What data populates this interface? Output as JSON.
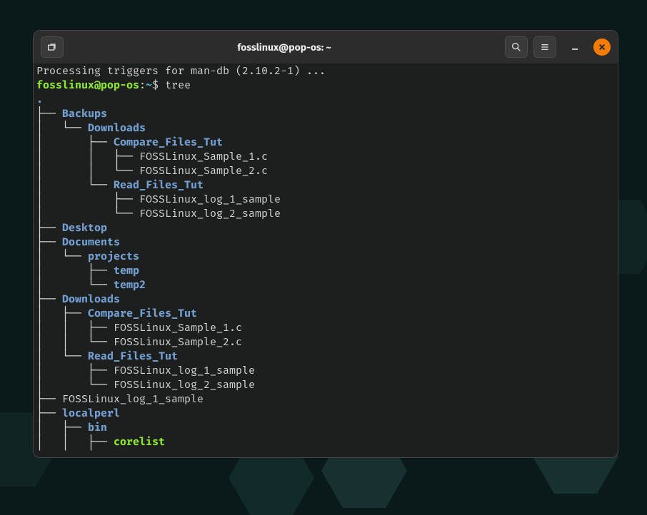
{
  "window": {
    "title": "fosslinux@pop-os: ~"
  },
  "prompt": {
    "user": "fosslinux@pop-os",
    "colon": ":",
    "path": "~",
    "symbol": "$ ",
    "command": "tree"
  },
  "output": {
    "preline": "Processing triggers for man-db (2.10.2-1) ...",
    "root": "."
  },
  "tree": [
    {
      "indent": 0,
      "branch": "├── ",
      "text": "Backups",
      "cls": "dirblue"
    },
    {
      "indent": 1,
      "branch": "└── ",
      "text": "Downloads",
      "cls": "dirblue",
      "pipes": "│   "
    },
    {
      "indent": 2,
      "branch": "├── ",
      "text": "Compare_Files_Tut",
      "cls": "dirblue",
      "pipes": "│       "
    },
    {
      "indent": 3,
      "branch": "├── ",
      "text": "FOSSLinux_Sample_1.c",
      "cls": "white",
      "pipes": "│       │   "
    },
    {
      "indent": 3,
      "branch": "└── ",
      "text": "FOSSLinux_Sample_2.c",
      "cls": "white",
      "pipes": "│       │   "
    },
    {
      "indent": 2,
      "branch": "└── ",
      "text": "Read_Files_Tut",
      "cls": "dirblue",
      "pipes": "│       "
    },
    {
      "indent": 3,
      "branch": "├── ",
      "text": "FOSSLinux_log_1_sample",
      "cls": "white",
      "pipes": "│           "
    },
    {
      "indent": 3,
      "branch": "└── ",
      "text": "FOSSLinux_log_2_sample",
      "cls": "white",
      "pipes": "│           "
    },
    {
      "indent": 0,
      "branch": "├── ",
      "text": "Desktop",
      "cls": "dirblue"
    },
    {
      "indent": 0,
      "branch": "├── ",
      "text": "Documents",
      "cls": "dirblue"
    },
    {
      "indent": 1,
      "branch": "└── ",
      "text": "projects",
      "cls": "dirblue",
      "pipes": "│   "
    },
    {
      "indent": 2,
      "branch": "├── ",
      "text": "temp",
      "cls": "dirblue",
      "pipes": "│       "
    },
    {
      "indent": 2,
      "branch": "└── ",
      "text": "temp2",
      "cls": "dirblue",
      "pipes": "│       "
    },
    {
      "indent": 0,
      "branch": "├── ",
      "text": "Downloads",
      "cls": "dirblue"
    },
    {
      "indent": 1,
      "branch": "├── ",
      "text": "Compare_Files_Tut",
      "cls": "dirblue",
      "pipes": "│   "
    },
    {
      "indent": 2,
      "branch": "├── ",
      "text": "FOSSLinux_Sample_1.c",
      "cls": "white",
      "pipes": "│   │   "
    },
    {
      "indent": 2,
      "branch": "└── ",
      "text": "FOSSLinux_Sample_2.c",
      "cls": "white",
      "pipes": "│   │   "
    },
    {
      "indent": 1,
      "branch": "└── ",
      "text": "Read_Files_Tut",
      "cls": "dirblue",
      "pipes": "│   "
    },
    {
      "indent": 2,
      "branch": "├── ",
      "text": "FOSSLinux_log_1_sample",
      "cls": "white",
      "pipes": "│       "
    },
    {
      "indent": 2,
      "branch": "└── ",
      "text": "FOSSLinux_log_2_sample",
      "cls": "white",
      "pipes": "│       "
    },
    {
      "indent": 0,
      "branch": "├── ",
      "text": "FOSSLinux_log_1_sample",
      "cls": "white"
    },
    {
      "indent": 0,
      "branch": "├── ",
      "text": "localperl",
      "cls": "dirblue"
    },
    {
      "indent": 1,
      "branch": "├── ",
      "text": "bin",
      "cls": "dirblue",
      "pipes": "│   "
    },
    {
      "indent": 2,
      "branch": "├── ",
      "text": "corelist",
      "cls": "execgreen",
      "pipes": "│   │   "
    }
  ]
}
